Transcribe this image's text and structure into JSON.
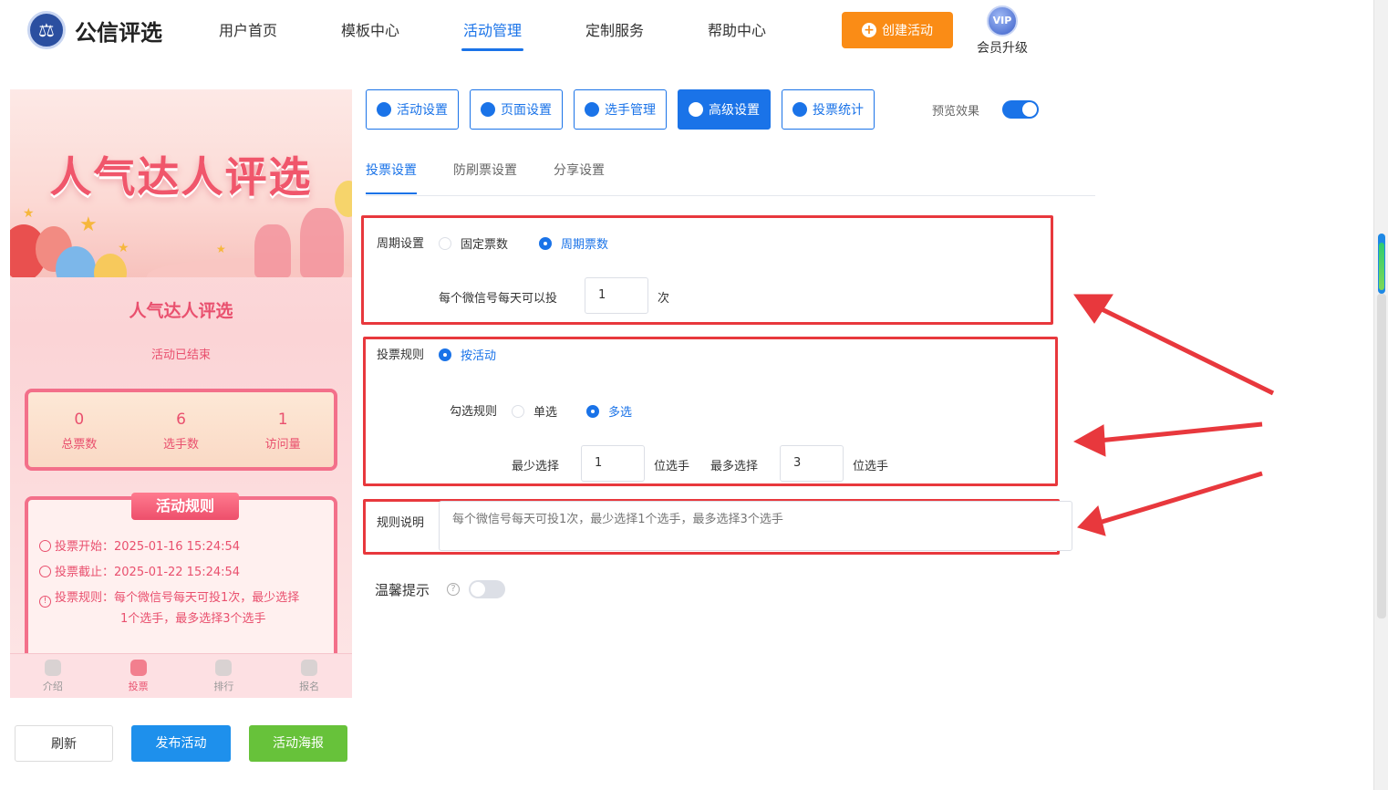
{
  "header": {
    "logo_text": "公信评选",
    "nav": [
      "用户首页",
      "模板中心",
      "活动管理",
      "定制服务",
      "帮助中心"
    ],
    "nav_active": "活动管理",
    "create_button": "创建活动",
    "vip_badge": "VIP",
    "vip_label": "会员升级"
  },
  "preview": {
    "banner_title": "人气达人评选",
    "event_name": "人气达人评选",
    "status": "活动已结束",
    "stats": [
      {
        "value": "0",
        "label": "总票数"
      },
      {
        "value": "6",
        "label": "选手数"
      },
      {
        "value": "1",
        "label": "访问量"
      }
    ],
    "rules_title": "活动规则",
    "rules": [
      "投票开始：2025-01-16 15:24:54",
      "投票截止：2025-01-22 15:24:54",
      "投票规则：每个微信号每天可投1次，最少选择",
      "1个选手，最多选择3个选手"
    ],
    "tabbar": [
      "介绍",
      "投票",
      "排行",
      "报名"
    ],
    "tabbar_active": "投票"
  },
  "actions": {
    "refresh": "刷新",
    "publish": "发布活动",
    "poster": "活动海报"
  },
  "toolbar": {
    "buttons": [
      "活动设置",
      "页面设置",
      "选手管理",
      "高级设置",
      "投票统计"
    ],
    "active": "高级设置",
    "preview_label": "预览效果",
    "preview_on": true
  },
  "subtabs": [
    "投票设置",
    "防刷票设置",
    "分享设置"
  ],
  "subtab_active": "投票设置",
  "form": {
    "cycle_label": "周期设置",
    "cycle_options": [
      "固定票数",
      "周期票数"
    ],
    "cycle_selected": "周期票数",
    "per_day_label": "每个微信号每天可以投",
    "per_day_value": "1",
    "per_day_unit": "次",
    "rule_label": "投票规则",
    "rule_option": "按活动",
    "check_label": "勾选规则",
    "check_options": [
      "单选",
      "多选"
    ],
    "check_selected": "多选",
    "min_label": "最少选择",
    "min_value": "1",
    "min_unit": "位选手",
    "max_label": "最多选择",
    "max_value": "3",
    "max_unit": "位选手",
    "desc_label": "规则说明",
    "desc_placeholder": "每个微信号每天可投1次，最少选择1个选手，最多选择3个选手",
    "tip_label": "温馨提示",
    "tip_on": false
  },
  "colors": {
    "primary": "#1a73e8",
    "orange": "#fa8c16",
    "green": "#67c23a",
    "highlight": "#e8383d",
    "pink": "#e9506e"
  }
}
